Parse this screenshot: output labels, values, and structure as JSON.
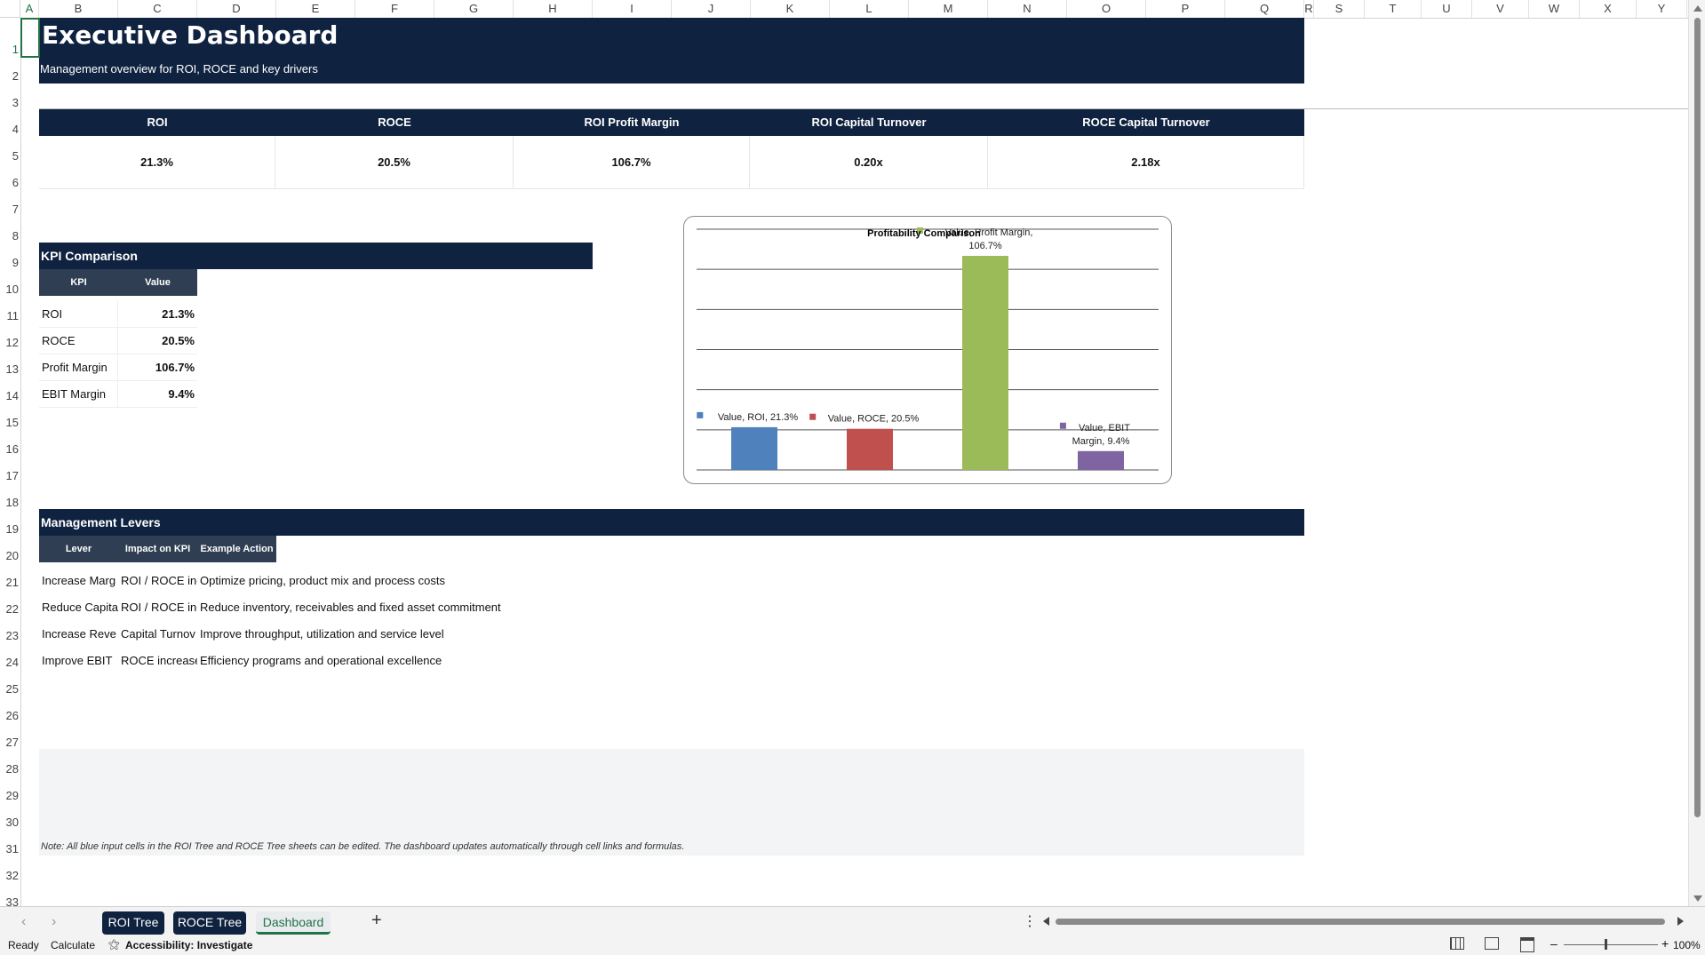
{
  "columns": [
    "A",
    "B",
    "C",
    "D",
    "E",
    "F",
    "G",
    "H",
    "I",
    "J",
    "K",
    "L",
    "M",
    "N",
    "O",
    "P",
    "Q",
    "R",
    "S",
    "T",
    "U",
    "V",
    "W",
    "X",
    "Y"
  ],
  "rows": [
    "1",
    "2",
    "3",
    "4",
    "5",
    "6",
    "7",
    "8",
    "9",
    "10",
    "11",
    "12",
    "13",
    "14",
    "15",
    "16",
    "17",
    "18",
    "19",
    "20",
    "21",
    "22",
    "23",
    "24",
    "25",
    "26",
    "27",
    "28",
    "29",
    "30",
    "31",
    "32",
    "33"
  ],
  "title": "Executive Dashboard",
  "subtitle": "Management overview for ROI, ROCE and key drivers",
  "kpis": [
    {
      "label": "ROI",
      "value": "21.3%"
    },
    {
      "label": "ROCE",
      "value": "20.5%"
    },
    {
      "label": "ROI Profit Margin",
      "value": "106.7%"
    },
    {
      "label": "ROI Capital Turnover",
      "value": "0.20x"
    },
    {
      "label": "ROCE Capital Turnover",
      "value": "2.18x"
    }
  ],
  "kpi_comparison": {
    "title": "KPI Comparison",
    "headers": [
      "KPI",
      "Value"
    ],
    "rows": [
      {
        "kpi": "ROI",
        "value": "21.3%"
      },
      {
        "kpi": "ROCE",
        "value": "20.5%"
      },
      {
        "kpi": "Profit Margin",
        "value": "106.7%"
      },
      {
        "kpi": "EBIT Margin",
        "value": "9.4%"
      }
    ]
  },
  "chart_data": {
    "type": "bar",
    "title": "Profitability Comparison",
    "categories": [
      "ROI",
      "ROCE",
      "Profit Margin",
      "EBIT Margin"
    ],
    "series": [
      {
        "name": "Value",
        "values": [
          21.3,
          20.5,
          106.7,
          9.4
        ]
      }
    ],
    "colors": [
      "#4f81bd",
      "#c0504d",
      "#9bbb59",
      "#8064a2"
    ],
    "data_labels": [
      "Value, ROI, 21.3%",
      "Value, ROCE, 20.5%",
      "Value, Profit Margin, 106.7%",
      "Value, EBIT Margin, 9.4%"
    ],
    "ylim": [
      0,
      120
    ],
    "grid": true
  },
  "levers": {
    "title": "Management Levers",
    "headers": [
      "Lever",
      "Impact on KPI",
      "Example Action"
    ],
    "rows": [
      {
        "lever": "Increase Marg",
        "impact": "ROI / ROCE inc",
        "action": "Optimize pricing, product mix and process costs"
      },
      {
        "lever": "Reduce Capita",
        "impact": "ROI / ROCE inc",
        "action": "Reduce inventory, receivables and fixed asset commitment"
      },
      {
        "lever": "Increase Reve",
        "impact": "Capital Turnov",
        "action": "Improve throughput, utilization and service level"
      },
      {
        "lever": "Improve EBIT",
        "impact": "ROCE increase",
        "action": "Efficiency programs and operational excellence"
      }
    ]
  },
  "note": "Note: All blue input cells in the ROI Tree and ROCE Tree sheets can be edited. The dashboard updates automatically through cell links and formulas.",
  "sheets": [
    {
      "label": "ROI Tree",
      "active": false
    },
    {
      "label": "ROCE Tree",
      "active": false
    },
    {
      "label": "Dashboard",
      "active": true
    }
  ],
  "status": {
    "ready": "Ready",
    "calculate": "Calculate",
    "accessibility": "Accessibility: Investigate",
    "zoom": "100%"
  },
  "colors": {
    "navy": "#0f2240",
    "slate": "#2f3e52",
    "accent_green": "#217346"
  }
}
